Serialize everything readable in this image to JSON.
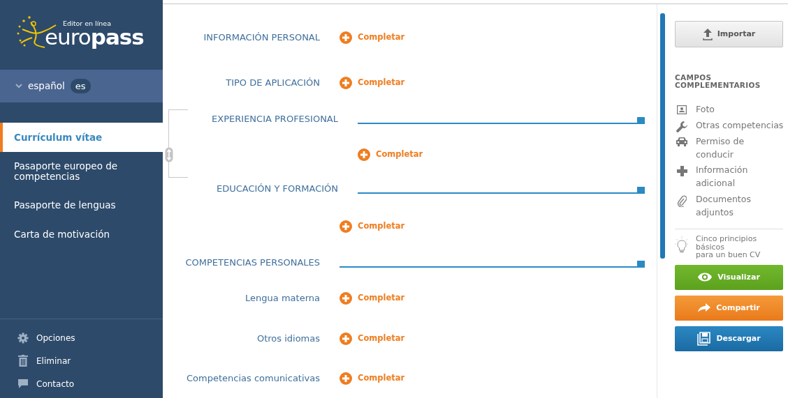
{
  "sidebar": {
    "logo": {
      "tagline": "Editor en línea",
      "wordmark": "euro**pass**"
    },
    "language": {
      "name": "español",
      "code": "es",
      "expanded": false
    },
    "documents": [
      {
        "label": "Currículum vítae",
        "selected": true
      },
      {
        "label": "Pasaporte europeo de competencias",
        "selected": false
      },
      {
        "label": "Pasaporte de lenguas",
        "selected": false
      },
      {
        "label": "Carta de motivación",
        "selected": false
      }
    ],
    "footer_items": [
      {
        "label": "Opciones",
        "kind": "gear"
      },
      {
        "label": "Eliminar",
        "kind": "trash"
      },
      {
        "label": "Contacto",
        "kind": "chat"
      }
    ]
  },
  "sections": [
    {
      "kind": "field",
      "label": "INFORMACIÓN PERSONAL",
      "action": "Completar"
    },
    {
      "kind": "field",
      "label": "TIPO DE APLICACIÓN",
      "action": "Completar"
    },
    {
      "kind": "group",
      "items": [
        {
          "kind": "header",
          "label": "EXPERIENCIA PROFESIONAL"
        },
        {
          "kind": "add",
          "action": "Completar"
        },
        {
          "kind": "header",
          "label": "EDUCACIÓN Y FORMACIÓN"
        }
      ]
    },
    {
      "kind": "add",
      "action": "Completar"
    },
    {
      "kind": "header",
      "label": "COMPETENCIAS PERSONALES"
    },
    {
      "kind": "field",
      "label": "Lengua materna",
      "action": "Completar"
    },
    {
      "kind": "field",
      "label": "Otros idiomas",
      "action": "Completar"
    },
    {
      "kind": "field",
      "label": "Competencias comunicativas",
      "action": "Completar"
    }
  ],
  "right_panel": {
    "import_button": "Importar",
    "heading": "CAMPOS COMPLEMENTARIOS",
    "extras": [
      {
        "label": "Foto",
        "kind": "photo"
      },
      {
        "label": "Otras competencias",
        "kind": "wrench"
      },
      {
        "label": "Permiso de conducir",
        "kind": "car"
      },
      {
        "label": "Información adicional",
        "kind": "plus"
      },
      {
        "label": "Documentos adjuntos",
        "kind": "clip"
      }
    ],
    "tip": "Cinco principios básicos\npara un buen CV",
    "actions": [
      {
        "label": "Visualizar",
        "kind": "view"
      },
      {
        "label": "Compartir",
        "kind": "share"
      },
      {
        "label": "Descargar",
        "kind": "download"
      }
    ]
  }
}
